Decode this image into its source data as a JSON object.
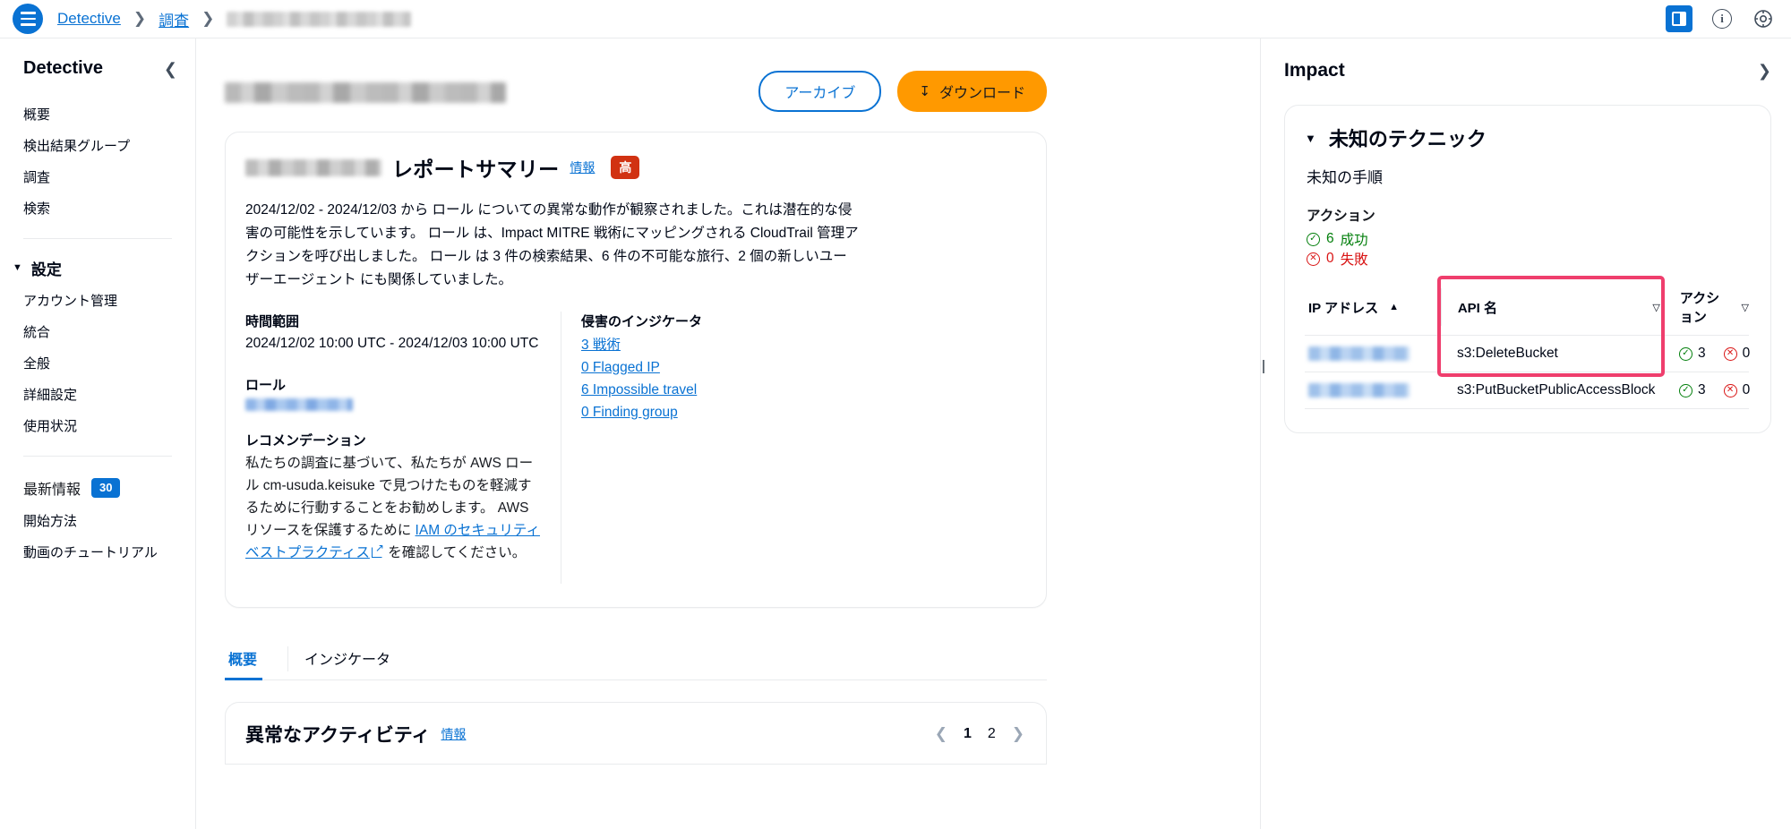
{
  "topbar": {
    "menu_icon": "hamburger-icon",
    "breadcrumbs": [
      {
        "label": "Detective",
        "type": "link"
      },
      {
        "label": "調査",
        "type": "link"
      },
      {
        "label": "",
        "type": "redacted"
      }
    ],
    "separator": "❯",
    "panel_toggle_icon": "side-panel-icon",
    "info_icon": "info-icon",
    "settings_icon": "settings-icon",
    "accent_color": "#0972d3"
  },
  "sidebar": {
    "title": "Detective",
    "collapse_icon": "chevron-left-icon",
    "items": [
      {
        "label": "概要"
      },
      {
        "label": "検出結果グループ"
      },
      {
        "label": "調査"
      },
      {
        "label": "検索"
      }
    ],
    "settings_group": {
      "caret": "▼",
      "label": "設定",
      "items": [
        {
          "label": "アカウント管理"
        },
        {
          "label": "統合"
        },
        {
          "label": "全般"
        },
        {
          "label": "詳細設定"
        },
        {
          "label": "使用状況"
        }
      ]
    },
    "footer": {
      "whats_new_label": "最新情報",
      "whats_new_count": "30",
      "items": [
        {
          "label": "開始方法"
        },
        {
          "label": "動画のチュートリアル"
        }
      ]
    }
  },
  "page": {
    "title_redacted": true,
    "archive_button": "アーカイブ",
    "download_button": "ダウンロード",
    "download_icon": "download-icon"
  },
  "summary_card": {
    "title": "レポートサマリー",
    "title_prefix_redacted": true,
    "info_link": "情報",
    "severity_badge": "高",
    "severity_color": "#d13212",
    "paragraph": "2024/12/02 - 2024/12/03 から ロール についての異常な動作が観察されました。これは潜在的な侵害の可能性を示しています。 ロール は、Impact MITRE 戦術にマッピングされる CloudTrail 管理アクションを呼び出しました。 ロール は 3 件の検索結果、6 件の不可能な旅行、2 個の新しいユーザーエージェント にも関係していました。",
    "time_range": {
      "label": "時間範囲",
      "value": "2024/12/02 10:00 UTC - 2024/12/03 10:00 UTC"
    },
    "role": {
      "label": "ロール",
      "value_redacted": true
    },
    "recommendation": {
      "label": "レコメンデーション",
      "text_before": "私たちの調査に基づいて、私たちが AWS ロール cm-usuda.keisuke で見つけたものを軽減するために行動することをお勧めします。 AWS リソースを保護するために ",
      "link_text": "IAM のセキュリティベストプラクティス",
      "external_icon": "external-link-icon",
      "text_after": " を確認してください。"
    },
    "ioc": {
      "label": "侵害のインジケータ",
      "links": [
        {
          "label": "3 戦術"
        },
        {
          "label": "0 Flagged IP"
        },
        {
          "label": "6 Impossible travel"
        },
        {
          "label": "0 Finding group"
        }
      ]
    }
  },
  "tabs": [
    {
      "label": "概要",
      "selected": true
    },
    {
      "label": "インジケータ",
      "selected": false
    }
  ],
  "activity_card": {
    "title": "異常なアクティビティ",
    "info_link": "情報",
    "pagination": {
      "prev_icon": "chevron-left-icon",
      "next_icon": "chevron-right-icon",
      "pages": [
        "1",
        "2"
      ],
      "current": "1"
    }
  },
  "impact_panel": {
    "title": "Impact",
    "expand_icon": "chevron-right-icon",
    "technique": {
      "caret": "▼",
      "name": "未知のテクニック",
      "procedure": "未知の手順",
      "actions_label": "アクション",
      "success": {
        "count": "6",
        "label": "成功",
        "icon": "check-circle-icon",
        "color": "#037f0c"
      },
      "failure": {
        "count": "0",
        "label": "失敗",
        "icon": "x-circle-icon",
        "color": "#d91515"
      }
    },
    "table": {
      "columns": [
        {
          "label": "IP アドレス",
          "sort": "▲"
        },
        {
          "label": "API 名",
          "sort": "▽"
        },
        {
          "label": "アクション",
          "sort": "▽"
        }
      ],
      "highlight_color": "#ef3e6d",
      "rows": [
        {
          "ip_redacted": true,
          "api_name": "s3:DeleteBucket",
          "success": "3",
          "failure": "0"
        },
        {
          "ip_redacted": true,
          "api_name": "s3:PutBucketPublicAccessBlock",
          "success": "3",
          "failure": "0"
        }
      ]
    }
  }
}
